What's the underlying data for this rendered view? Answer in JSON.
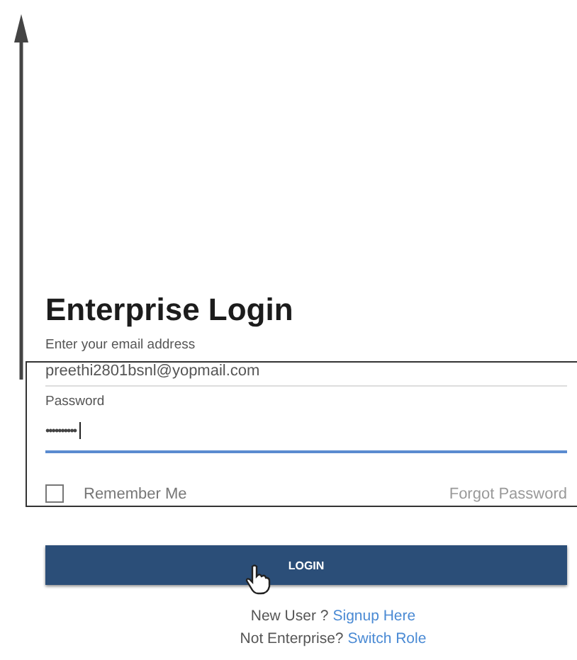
{
  "title": "Enterprise Login",
  "email": {
    "label": "Enter your email address",
    "value": "preethi2801bsnl@yopmail.com"
  },
  "password": {
    "label": "Password",
    "value": "••••••••••"
  },
  "remember": {
    "label": "Remember Me",
    "checked": false
  },
  "forgot_password": "Forgot Password",
  "login_button": "LOGIN",
  "signup": {
    "prompt": "New User ?",
    "link": "Signup Here"
  },
  "switch_role": {
    "prompt": "Not Enterprise?",
    "link": "Switch Role"
  }
}
